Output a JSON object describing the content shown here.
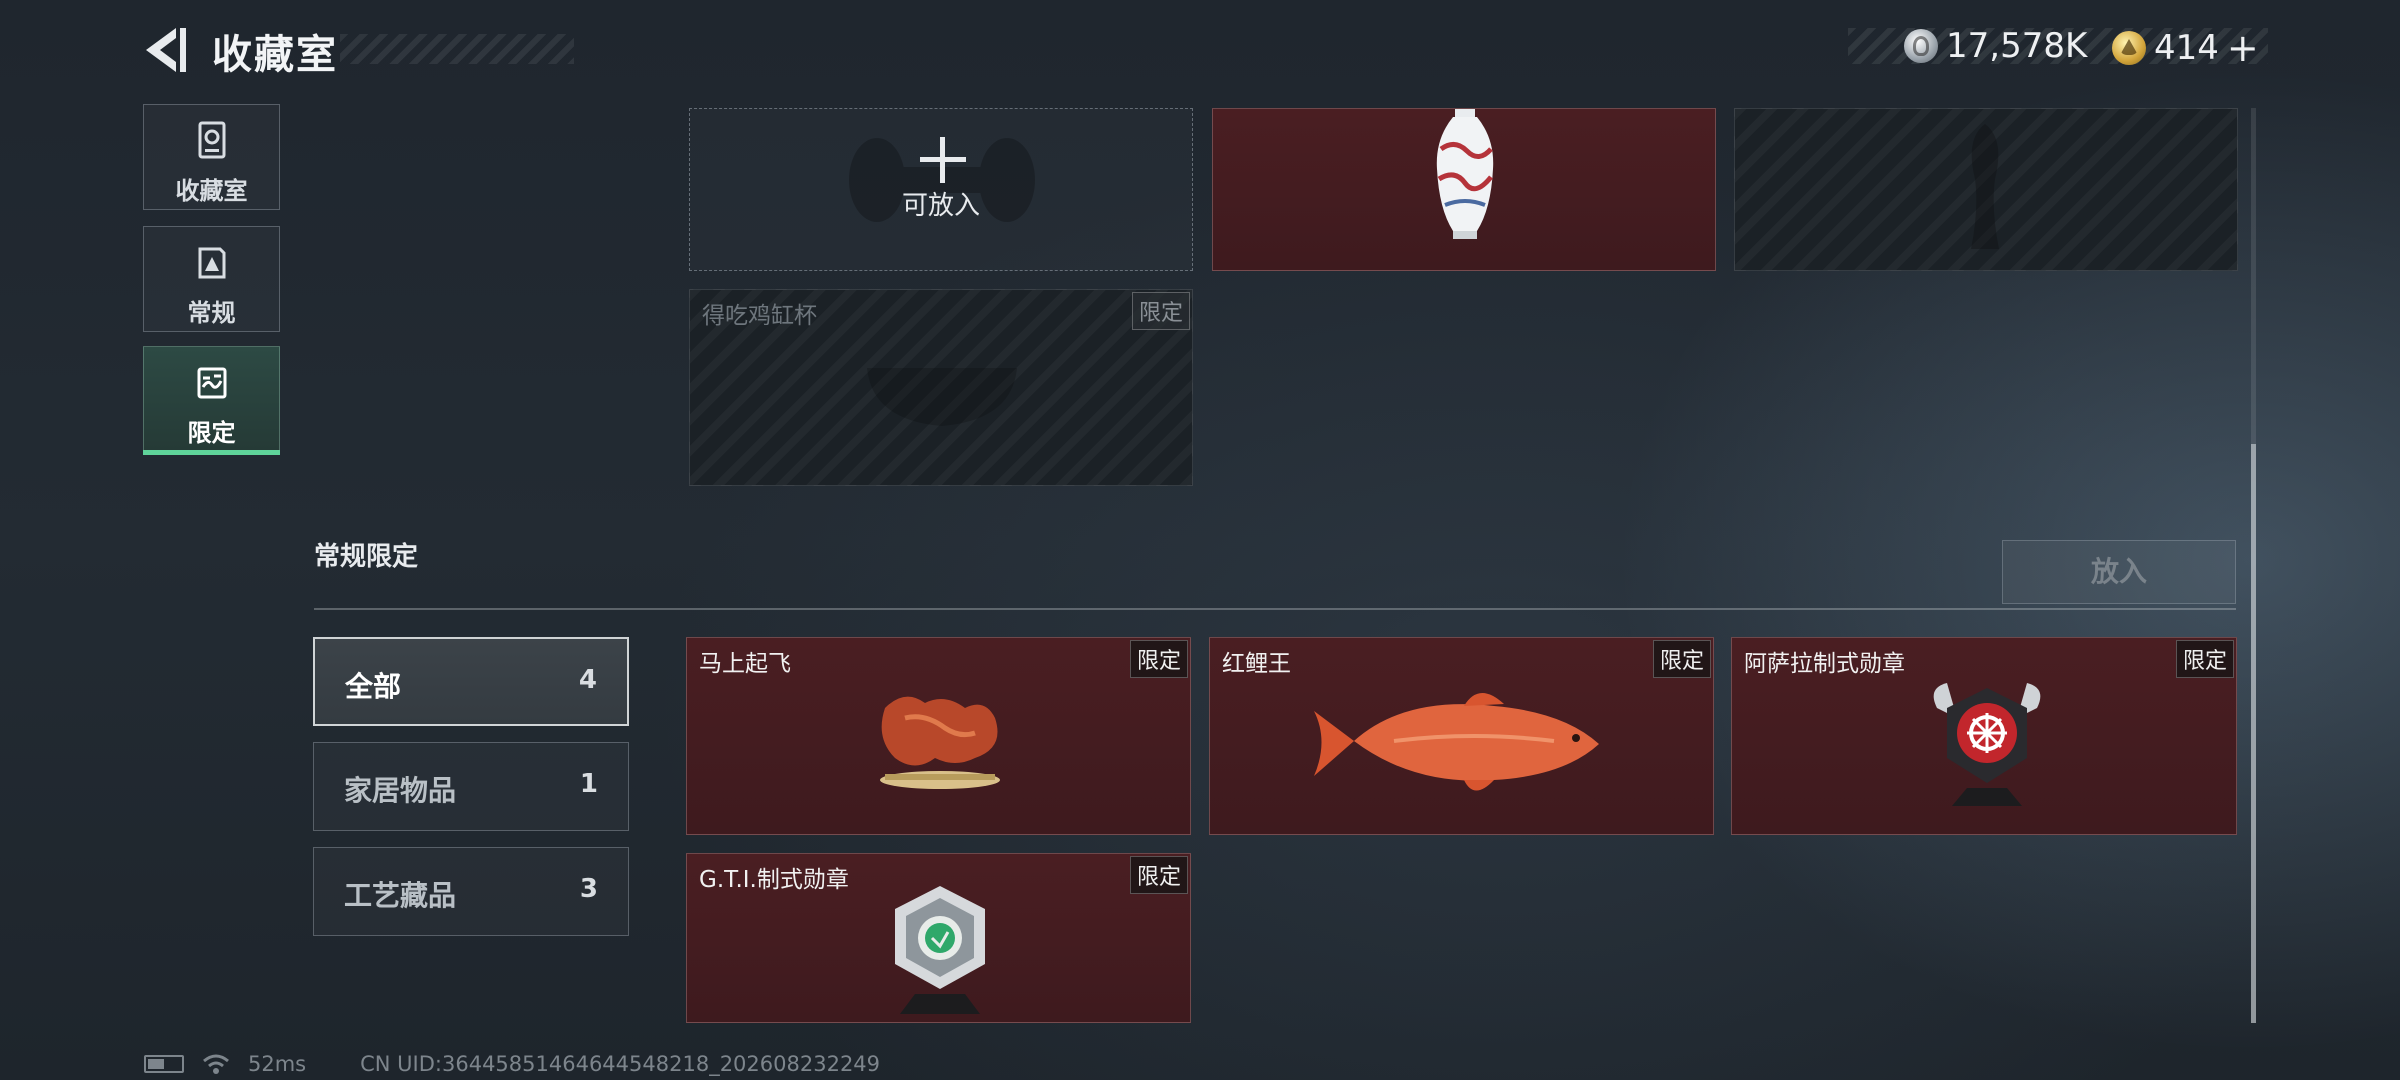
{
  "header": {
    "title": "收藏室",
    "currencies": [
      {
        "icon": "silver-coin-icon",
        "amount": "17,578K"
      },
      {
        "icon": "gold-coin-icon",
        "amount": "414",
        "add_symbol": "+"
      }
    ]
  },
  "nav": {
    "items": [
      {
        "label": "收藏室",
        "icon": "collection-room-icon",
        "active": false
      },
      {
        "label": "常规",
        "icon": "regular-icon",
        "active": false
      },
      {
        "label": "限定",
        "icon": "limited-icon",
        "active": true
      }
    ]
  },
  "upper_grid": {
    "empty_slot_label": "可放入",
    "locked_card": {
      "name": "得吃鸡缸杯",
      "tag": "限定"
    }
  },
  "section": {
    "title": "常规限定",
    "place_button": "放入"
  },
  "filters": [
    {
      "label": "全部",
      "count": "4",
      "active": true
    },
    {
      "label": "家居物品",
      "count": "1",
      "active": false
    },
    {
      "label": "工艺藏品",
      "count": "3",
      "active": false
    }
  ],
  "items": [
    {
      "name": "马上起飞",
      "tag": "限定"
    },
    {
      "name": "红鲤王",
      "tag": "限定"
    },
    {
      "name": "阿萨拉制式勋章",
      "tag": "限定"
    },
    {
      "name": "G.T.I.制式勋章",
      "tag": "限定"
    }
  ],
  "status": {
    "ping": "52ms",
    "uid": "CN UID:36445851464644548218_202608232249"
  },
  "colors": {
    "accent": "#5fd39a",
    "card_red": "#4a1e22",
    "background": "#212930"
  }
}
